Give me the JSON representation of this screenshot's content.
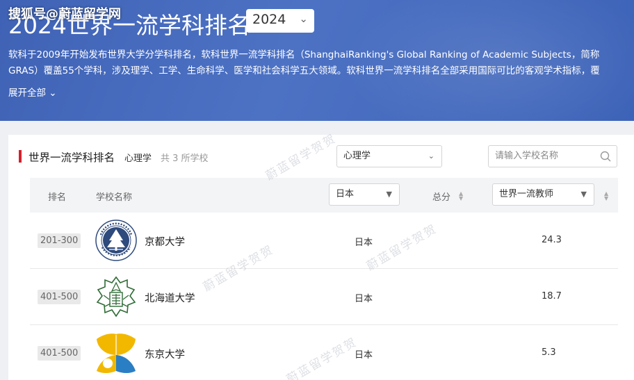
{
  "watermark_top": "搜狐号@蔚蓝留学网",
  "watermark_diagonal": "蔚蓝留学贺贺",
  "banner": {
    "title": "2024世界一流学科排名",
    "year": "2024",
    "description": "软科于2009年开始发布世界大学分学科排名，软科世界一流学科排名（ShanghaiRanking's Global Ranking of Academic Subjects，简称GRAS）覆盖55个学科，涉及理学、工学、生命科学、医学和社会科学五大领域。软科世界一流学科排名全部采用国际可比的客观学术指标，覆",
    "expand_label": "展开全部"
  },
  "section": {
    "title": "世界一流学科排名",
    "subject": "心理学",
    "count_label": "共 3 所学校",
    "subject_select": "心理学",
    "search_placeholder": "请输入学校名称"
  },
  "table": {
    "headers": {
      "rank": "排名",
      "name": "学校名称",
      "country_filter": "日本",
      "score": "总分",
      "metric_filter": "世界一流教师"
    },
    "rows": [
      {
        "rank": "201-300",
        "name": "京都大学",
        "country": "日本",
        "score": "24.3",
        "logo": "kyoto-university-logo"
      },
      {
        "rank": "401-500",
        "name": "北海道大学",
        "country": "日本",
        "score": "18.7",
        "logo": "hokkaido-university-logo"
      },
      {
        "rank": "401-500",
        "name": "东京大学",
        "country": "日本",
        "score": "5.3",
        "logo": "tokyo-university-logo"
      }
    ]
  },
  "colors": {
    "banner_blue": "#4a6fc0",
    "accent_red": "#d6202a",
    "kyoto_blue": "#2f4a7c",
    "hokkaido_green": "#2e6b35",
    "tokyo_yellow": "#f2b800",
    "tokyo_blue": "#2a7fc4"
  }
}
